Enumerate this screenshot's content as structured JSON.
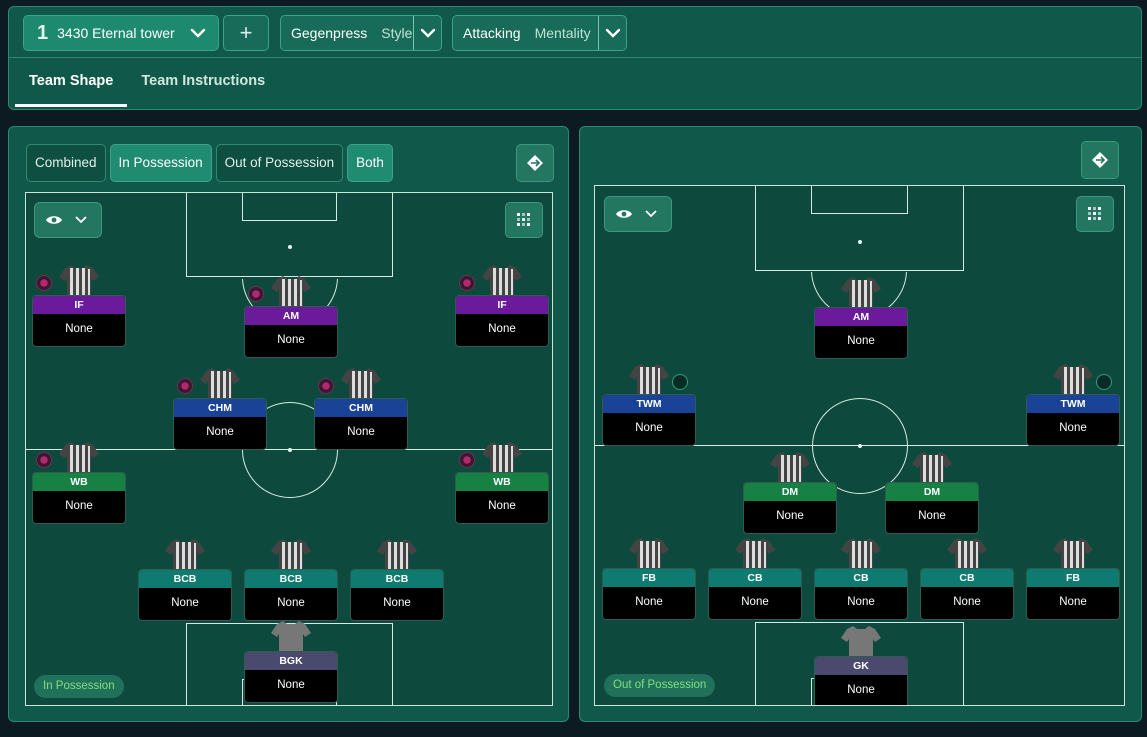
{
  "header": {
    "tactic_number": "1",
    "tactic_name": "3430 Eternal tower",
    "add_label": "+",
    "style_value": "Gegenpress",
    "style_label": "Style",
    "mentality_value": "Attacking",
    "mentality_label": "Mentality",
    "tabs": [
      "Team Shape",
      "Team Instructions"
    ]
  },
  "left_panel": {
    "filters": [
      "Combined",
      "In Possession",
      "Out of Possession",
      "Both"
    ],
    "badge": "In Possession",
    "players": [
      {
        "role": "IF",
        "value": "None"
      },
      {
        "role": "AM",
        "value": "None"
      },
      {
        "role": "IF",
        "value": "None"
      },
      {
        "role": "CHM",
        "value": "None"
      },
      {
        "role": "CHM",
        "value": "None"
      },
      {
        "role": "WB",
        "value": "None"
      },
      {
        "role": "WB",
        "value": "None"
      },
      {
        "role": "BCB",
        "value": "None"
      },
      {
        "role": "BCB",
        "value": "None"
      },
      {
        "role": "BCB",
        "value": "None"
      },
      {
        "role": "BGK",
        "value": "None"
      }
    ]
  },
  "right_panel": {
    "badge": "Out of Possession",
    "players": [
      {
        "role": "AM",
        "value": "None"
      },
      {
        "role": "TWM",
        "value": "None"
      },
      {
        "role": "TWM",
        "value": "None"
      },
      {
        "role": "DM",
        "value": "None"
      },
      {
        "role": "DM",
        "value": "None"
      },
      {
        "role": "FB",
        "value": "None"
      },
      {
        "role": "CB",
        "value": "None"
      },
      {
        "role": "CB",
        "value": "None"
      },
      {
        "role": "CB",
        "value": "None"
      },
      {
        "role": "FB",
        "value": "None"
      },
      {
        "role": "GK",
        "value": "None"
      }
    ]
  },
  "colors": {
    "attacker": "#6a1a9a",
    "midfielder": "#1a4296",
    "wide": "#178043",
    "defender": "#0e7a70",
    "goalkeeper": "#4a4a6e",
    "panel": "#10594a"
  }
}
